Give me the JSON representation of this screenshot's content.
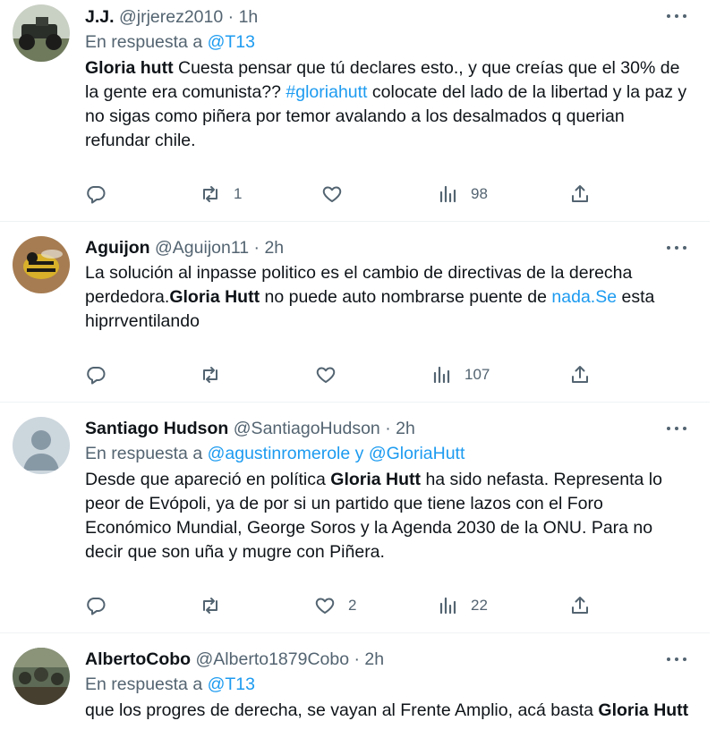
{
  "tweets": [
    {
      "name": "J.J.",
      "handle": "@jrjerez2010",
      "sep": "·",
      "time": "1h",
      "reply_prefix": "En respuesta a ",
      "reply_to_1": "@T13",
      "text": {
        "b1": "Gloria hutt",
        "t1": " Cuesta pensar que tú declares esto., y que creías que el 30% de la gente era comunista?? ",
        "hashtag": "#gloriahutt",
        "t2": " colocate  del lado de la libertad y la paz y no sigas como piñera por temor avalando a los desalmados q querian refundar chile."
      },
      "counts": {
        "reply": "",
        "retweet": "1",
        "like": "",
        "views": "98"
      }
    },
    {
      "name": "Aguijon",
      "handle": "@Aguijon11",
      "sep": "·",
      "time": "2h",
      "text": {
        "t1": "La solución al inpasse politico es el cambio de directivas de la derecha perdedora.",
        "b1": "Gloria Hutt",
        "t2": " no puede auto nombrarse puente de ",
        "link": "nada.Se",
        "t3": " esta hiprrventilando"
      },
      "counts": {
        "reply": "",
        "retweet": "",
        "like": "",
        "views": "107"
      }
    },
    {
      "name": "Santiago Hudson",
      "handle": "@SantiagoHudson",
      "sep": "·",
      "time": "2h",
      "reply_prefix": "En respuesta a ",
      "reply_to_1": "@agustinromerole",
      "reply_joiner": " y ",
      "reply_to_2": "@GloriaHutt",
      "text": {
        "t1": "Desde que apareció en política ",
        "b1": "Gloria Hutt",
        "t2": " ha sido nefasta. Representa lo peor de Evópoli, ya de por si un partido que tiene lazos con el Foro Económico Mundial, George Soros y la Agenda 2030 de la ONU. Para no decir que son uña y mugre con Piñera."
      },
      "counts": {
        "reply": "",
        "retweet": "",
        "like": "2",
        "views": "22"
      }
    },
    {
      "name": "AlbertoCobo",
      "handle": "@Alberto1879Cobo",
      "sep": "·",
      "time": "2h",
      "reply_prefix": "En respuesta a ",
      "reply_to_1": "@T13",
      "text": {
        "t1": "que los progres de derecha, se vayan al Frente Amplio, acá basta ",
        "b1": "Gloria Hutt"
      }
    }
  ],
  "icons": {
    "reply": "speech-bubble-icon",
    "retweet": "retweet-arrows-icon",
    "like": "heart-icon",
    "views": "bar-chart-icon",
    "share": "share-upload-icon",
    "more": "ellipsis-icon"
  },
  "colors": {
    "link": "#1d9bf0",
    "secondary": "#536471",
    "text": "#0f1419",
    "divider": "#eff3f4"
  }
}
